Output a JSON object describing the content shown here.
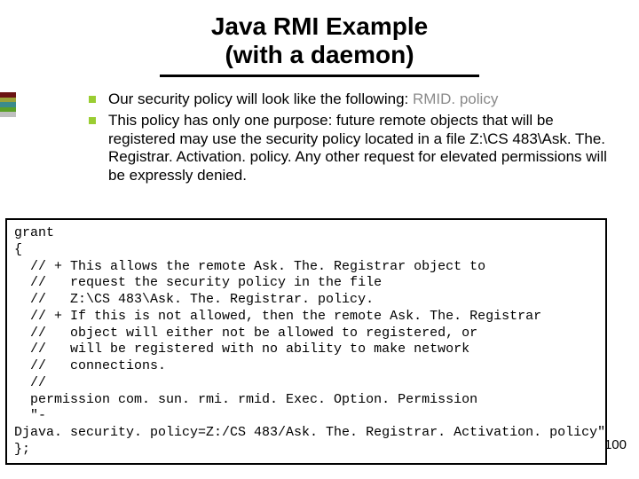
{
  "title": {
    "line1": "Java RMI Example",
    "line2": "(with a daemon)"
  },
  "bullets": [
    {
      "prefix": "Our security policy will look like the following: ",
      "rmid": "RMID. policy"
    },
    {
      "text": "This policy has only one purpose: future remote objects that will be registered may use the security policy located in a file Z:\\CS 483\\Ask. The. Registrar. Activation. policy.  Any other request for elevated permissions will be expressly denied."
    }
  ],
  "code": "grant\n{\n  // + This allows the remote Ask. The. Registrar object to\n  //   request the security policy in the file\n  //   Z:\\CS 483\\Ask. The. Registrar. policy.\n  // + If this is not allowed, then the remote Ask. The. Registrar\n  //   object will either not be allowed to registered, or\n  //   will be registered with no ability to make network\n  //   connections.\n  //\n  permission com. sun. rmi. rmid. Exec. Option. Permission\n  \"-\nDjava. security. policy=Z:/CS 483/Ask. The. Registrar. Activation. policy\";\n};",
  "page_number": "100"
}
